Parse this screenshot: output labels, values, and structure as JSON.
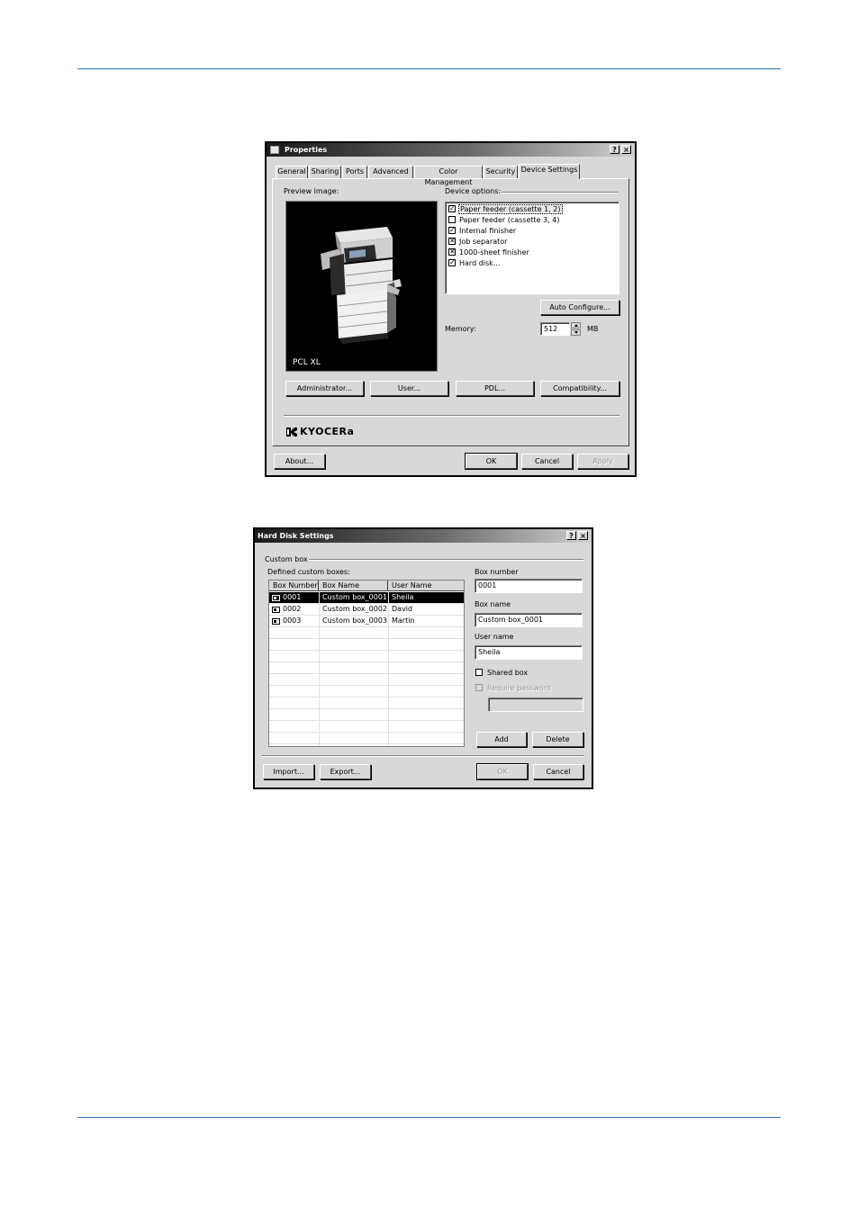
{
  "properties_dialog": {
    "title": "Properties",
    "help_btn": "?",
    "close_btn": "×",
    "tabs": [
      "General",
      "Sharing",
      "Ports",
      "Advanced",
      "Color Management",
      "Security",
      "Device Settings"
    ],
    "preview_label": "Preview image:",
    "preview_caption": "PCL XL",
    "device_options_label": "Device options:",
    "device_options": [
      {
        "label": "Paper feeder (cassette 1, 2)",
        "mark": "✓",
        "selected": true
      },
      {
        "label": "Paper feeder (cassette 3, 4)",
        "mark": "",
        "selected": false
      },
      {
        "label": "Internal finisher",
        "mark": "✓",
        "selected": false
      },
      {
        "label": "Job separator",
        "mark": "✕",
        "selected": false
      },
      {
        "label": "1000-sheet finisher",
        "mark": "✕",
        "selected": false
      },
      {
        "label": "Hard disk...",
        "mark": "✓",
        "selected": false
      }
    ],
    "auto_configure": "Auto Configure...",
    "memory_label": "Memory:",
    "memory_value": "512",
    "memory_unit": "MB",
    "buttons": {
      "administrator": "Administrator...",
      "user": "User...",
      "pdl": "PDL...",
      "compatibility": "Compatibility..."
    },
    "brand": "KYOCERa",
    "about": "About...",
    "ok": "OK",
    "cancel": "Cancel",
    "apply": "Apply"
  },
  "hard_disk_dialog": {
    "title": "Hard Disk Settings",
    "help_btn": "?",
    "close_btn": "×",
    "custom_box_label": "Custom box",
    "defined_label": "Defined custom boxes:",
    "columns": [
      "Box Number",
      "Box Name",
      "User Name"
    ],
    "rows": [
      {
        "number": "0001",
        "name": "Custom box_0001",
        "user": "Sheila",
        "selected": true
      },
      {
        "number": "0002",
        "name": "Custom box_0002",
        "user": "David",
        "selected": false
      },
      {
        "number": "0003",
        "name": "Custom box_0003",
        "user": "Martin",
        "selected": false
      }
    ],
    "box_number_label": "Box number",
    "box_number_value": "0001",
    "box_name_label": "Box name",
    "box_name_value": "Custom box_0001",
    "user_name_label": "User name",
    "user_name_value": "Sheila",
    "shared_box_label": "Shared box",
    "require_password_label": "Require password",
    "add": "Add",
    "delete": "Delete",
    "import": "Import...",
    "export": "Export...",
    "ok": "OK",
    "cancel": "Cancel"
  }
}
